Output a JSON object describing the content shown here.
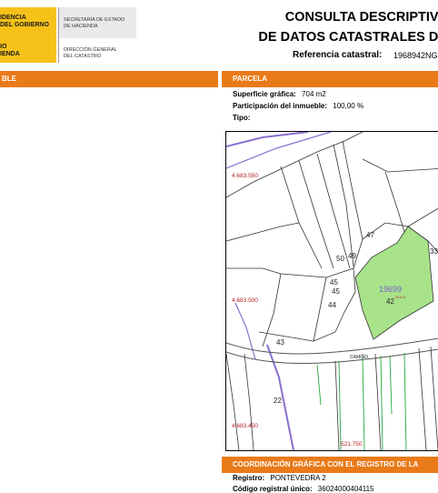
{
  "header": {
    "gov_lines": [
      "IDENCIA",
      "DEL GOBIERNO",
      "IO",
      "IENDA"
    ],
    "secretaria_lines": [
      "SECRETARÍA DE ESTADO",
      "DE HACIENDA"
    ],
    "direccion_lines": [
      "DIRECCIÓN GENERAL",
      "DEL CATASTRO"
    ],
    "title_line1": "CONSULTA DESCRIPTIVA",
    "title_line2": "DE DATOS CATASTRALES DE",
    "ref_label": "Referencia catastral:",
    "ref_value": "1968942NG"
  },
  "left_section": {
    "label": "BLE"
  },
  "parcela": {
    "label": "PARCELA",
    "superficie_label": "Superficie gráfica:",
    "superficie_value": "704 m2",
    "participacion_label": "Participación del inmueble:",
    "participacion_value": "100,00 %",
    "tipo_label": "Tipo:",
    "tipo_value": ""
  },
  "map": {
    "coords": {
      "y1": "4.683.550",
      "y2": "4.683.500",
      "y3": "4.683.450",
      "x1": "521.750"
    },
    "parcels": [
      "47",
      "33",
      "50",
      "49",
      "45",
      "45",
      "44",
      "42",
      "43",
      "22"
    ],
    "highlight_label": "19699",
    "road_label": "CAMIÑO",
    "small_label": "SOLO",
    "colors": {
      "highlight_fill": "#a8e38a",
      "boundary_purple": "#8a6fcf",
      "parcel_line": "#333333",
      "green_line": "#1fa83a"
    }
  },
  "registro": {
    "label": "COORDINACIÓN GRÁFICA CON EL REGISTRO DE LA",
    "registro_label": "Registro:",
    "registro_value": "PONTEVEDRA 2",
    "codigo_label": "Código registral único:",
    "codigo_value": "36024000404115"
  }
}
